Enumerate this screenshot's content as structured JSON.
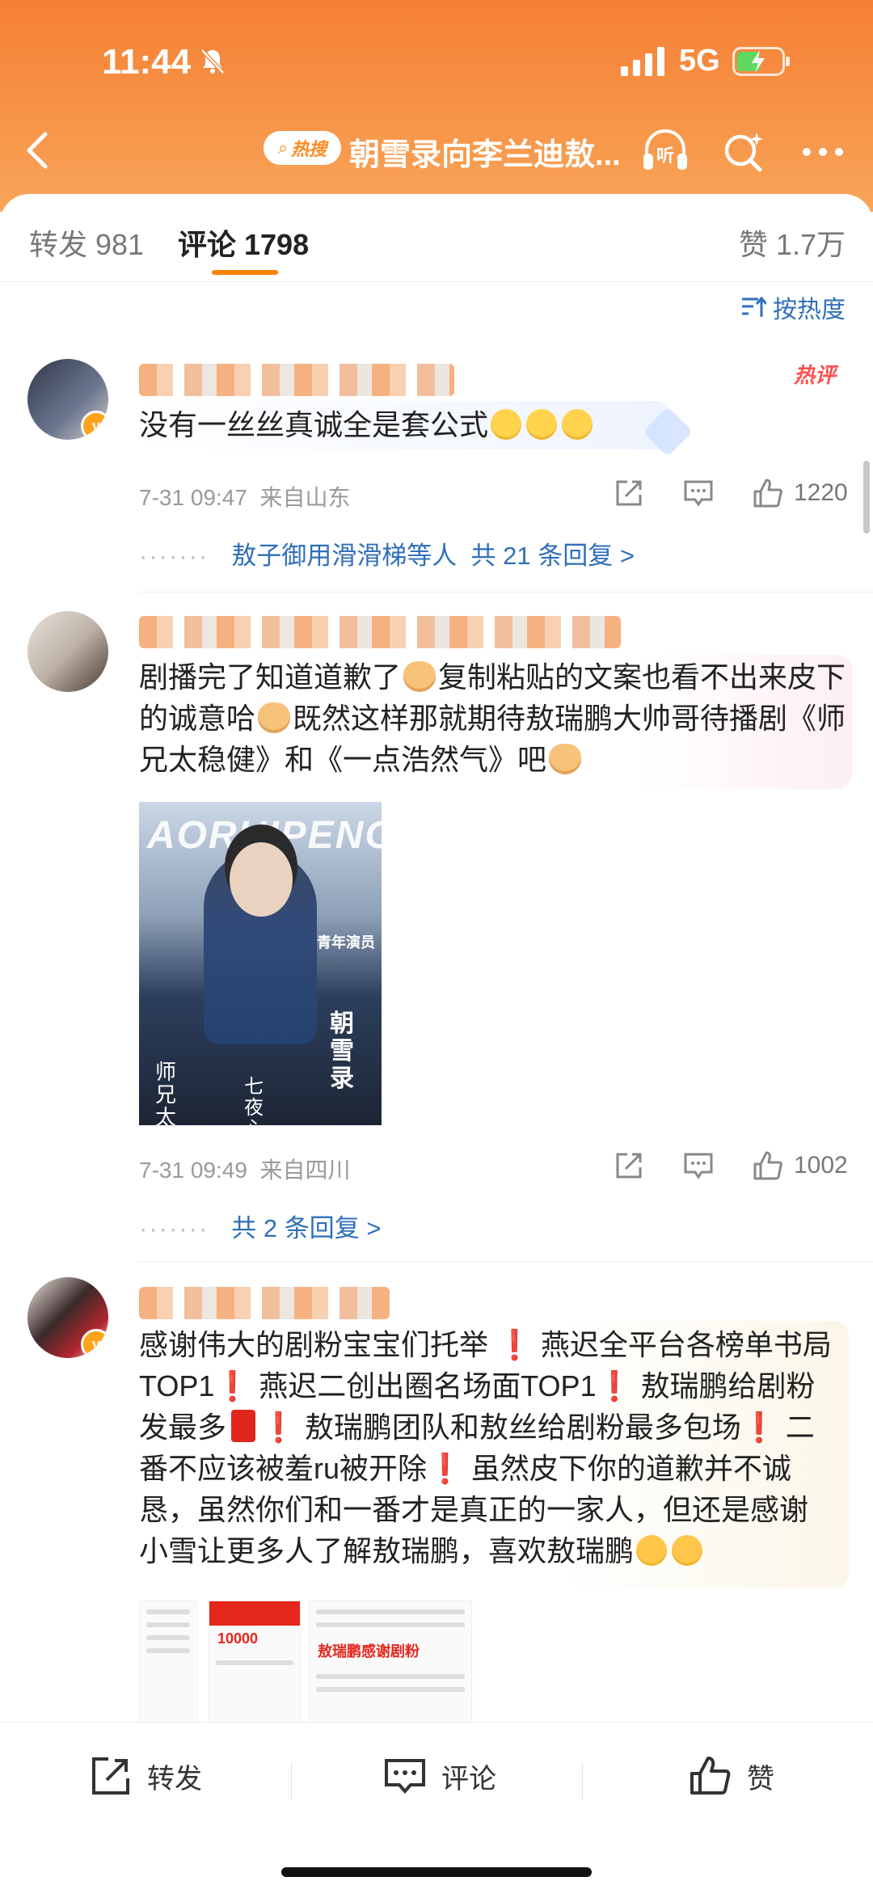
{
  "status_bar": {
    "time": "11:44",
    "network": "5G"
  },
  "nav": {
    "hot_badge": "热搜",
    "title": "朝雪录向李兰迪敖...",
    "listen_label": "听"
  },
  "tabs": {
    "repost_label": "转发",
    "repost_count": "981",
    "comment_label": "评论",
    "comment_count": "1798",
    "like_label": "赞",
    "like_count": "1.7万"
  },
  "sort_label": "按热度",
  "comments": [
    {
      "hot_tag": "热评",
      "text": "没有一丝丝真诚全是套公式",
      "date": "7-31 09:47",
      "location": "来自山东",
      "likes": "1220",
      "replies_prefix": "敖子御用滑滑梯等人",
      "replies_link": "共 21 条回复 >"
    },
    {
      "text_parts": [
        "剧播完了知道道歉了",
        "复制粘贴的文案也看不出来皮下的诚意哈",
        "既然这样那就期待敖瑞鹏大帅哥待播剧《师兄太稳健》和《一点浩然气》吧"
      ],
      "poster": {
        "brand": "AORUIPENG",
        "label": "青年演员",
        "title1": "朝雪录",
        "title2": "师兄太稳健",
        "title3": "七夜心"
      },
      "date": "7-31 09:49",
      "location": "来自四川",
      "likes": "1002",
      "replies_link": "共 2 条回复 >"
    },
    {
      "text_parts": [
        "感谢伟大的剧粉宝宝们托举",
        "燕迟全平台各榜单书局TOP1",
        "燕迟二创出圈名场面TOP1",
        "敖瑞鹏给剧粉发最多",
        "敖瑞鹏团队和敖丝给剧粉最多包场",
        "二番不应该被羞ru被开除",
        "虽然皮下你的道歉并不诚恳，虽然你们和一番才是真正的一家人，但还是感谢小雪让更多人了解敖瑞鹏，喜欢敖瑞鹏"
      ],
      "thumb_label": "敖瑞鹏感谢剧粉",
      "thumb_amount": "10000"
    }
  ],
  "bottom_bar": {
    "repost": "转发",
    "comment": "评论",
    "like": "赞"
  }
}
